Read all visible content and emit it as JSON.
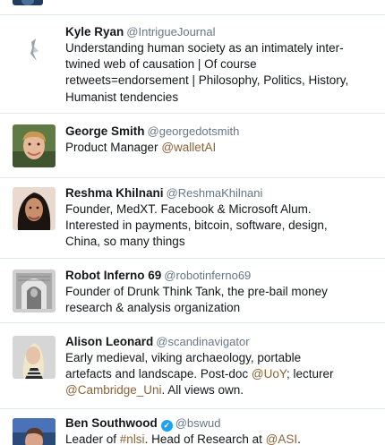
{
  "users": [
    {
      "name": "Kyle Ryan",
      "handle": "@IntrigueJournal",
      "bio": [
        "Understanding human society as an intimately inter-",
        "twined web of causation | Of course",
        "retweets=endorsement | Philosophy, Politics, History,",
        "Humanist tendencies"
      ]
    },
    {
      "name": "George Smith",
      "handle": "@georgedotsmith",
      "bio_prefix": "Product Manager ",
      "bio_link": "@walletAI"
    },
    {
      "name": "Reshma Khilnani",
      "handle": "@ReshmaKhilnani",
      "bio": [
        "Founder, MedXT. Facebook & Microsoft Alum.",
        "Interested in payments, bitcoin, software, design,",
        "China, so many things"
      ]
    },
    {
      "name": "Robot Inferno 69",
      "handle": "@robotinferno69",
      "bio": [
        "Founder of Drunk Think Tank, the pre-bail money",
        "research & analysis organization"
      ]
    },
    {
      "name": "Alison Leonard",
      "handle": "@scandinavigator",
      "bio_line1": "Early medieval, viking archaeology, portable",
      "bio_line2_prefix": "artefacts and landscape. Post-doc ",
      "bio_line2_link": "@UoY",
      "bio_line2_suffix": "; lecturer",
      "bio_line3_link": "@Cambridge_Uni",
      "bio_line3_suffix": ". All views own."
    },
    {
      "name": "Ben Southwood",
      "handle": "@bswud",
      "verified": "✓",
      "bio_prefix": "Leader of ",
      "bio_link1": "#nlsi",
      "bio_middle": ". Head of Research at ",
      "bio_link2": "@ASI",
      "bio_suffix": "."
    }
  ],
  "colors": {
    "link": "#8c6238",
    "handle": "#657786",
    "divider": "#e1e8ed",
    "verified": "#1da1f2"
  }
}
